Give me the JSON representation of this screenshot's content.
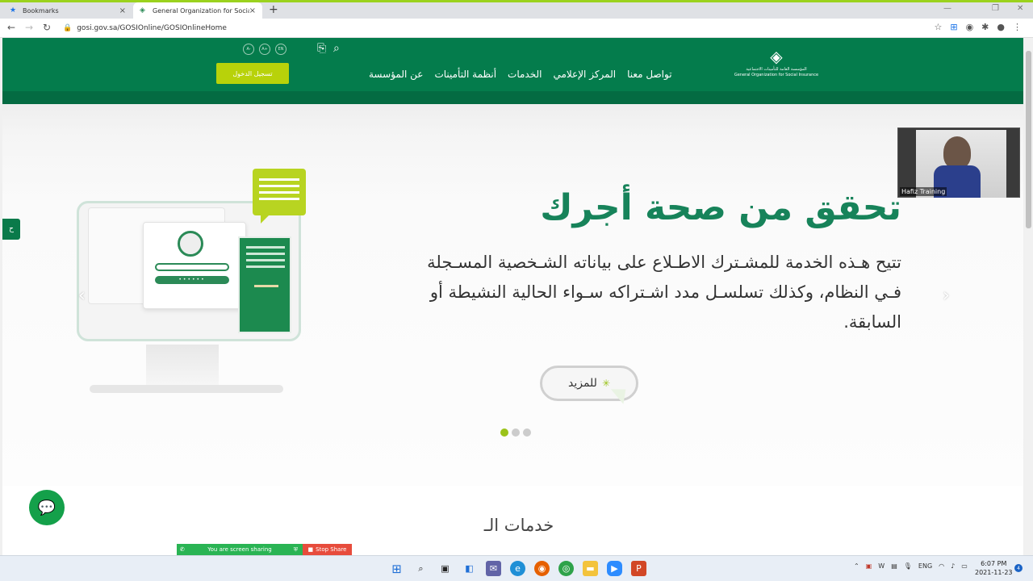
{
  "browser": {
    "tabs": [
      {
        "label": "Bookmarks",
        "icon": "star-icon"
      },
      {
        "label": "General Organization for Social",
        "icon": "gosi-favicon"
      }
    ],
    "url": "gosi.gov.sa/GOSIOnline/GOSIOnlineHome",
    "new_tab": "+",
    "close": "×"
  },
  "header": {
    "logo_ar": "المؤسسة العامة للتأمينات الاجتماعية",
    "logo_en": "General Organization for Social Insurance",
    "nav": [
      "عن المؤسسة",
      "أنظمة التأمينات",
      "الخدمات",
      "المركز الإعلامي",
      "تواصل معنا"
    ],
    "login": "تسجيل الدخول",
    "font_controls": [
      "A-",
      "A+",
      "EN"
    ]
  },
  "hero": {
    "title": "تحقق من صحة أجرك",
    "description": "تتيح هـذه الخدمة للمشـترك الاطـلاع على بياناته الشـخصية المسـجلة فـي النظام، وكذلك تسلسـل مدد اشـتراكه سـواء الحالية النشيطة أو السابقة.",
    "more_button": "للمزيد",
    "slides": 3,
    "active_slide": 1
  },
  "services": {
    "title": "خدمات الـ"
  },
  "side_tab": "ح",
  "video": {
    "name": "Hafiz Training"
  },
  "share": {
    "status": "You are screen sharing",
    "stop": "Stop Share"
  },
  "taskbar": {
    "lang": "ENG",
    "time": "6:07 PM",
    "date": "2021-11-23",
    "notifications": "4"
  },
  "colors": {
    "brand_green": "#047c4c",
    "accent_lime": "#b8d20a",
    "title_green": "#17835a"
  }
}
